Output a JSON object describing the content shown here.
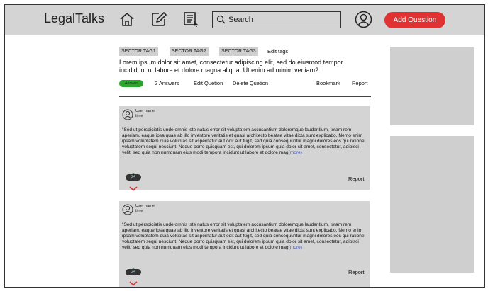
{
  "header": {
    "brand": "LegalTalks",
    "search_placeholder": "Search",
    "add_question_label": "Add Question",
    "accent_color": "#e03232"
  },
  "question": {
    "tags": [
      "SECTOR TAG1",
      "SECTOR TAG2",
      "SECTOR TAG3"
    ],
    "edit_tags_label": "Edit tags",
    "title": "Lorem ipsum dolor sit amet, consectetur adipiscing elit, sed do eiusmod tempor incididunt ut labore et dolore magna aliqua. Ut enim ad minim veniam?",
    "answer_label": "Answer",
    "answers_count": "2 Answers",
    "edit_label": "Edit Quetion",
    "delete_label": "Delete Quetion",
    "bookmark_label": "Bookmark",
    "report_label": "Report"
  },
  "answers": [
    {
      "user": "User name",
      "time": "time",
      "text": "\"Sed ut perspiciatis unde omnis iste natus error sit voluptatem accusantium doloremque laudantium, totam rem aperiam, eaque ipsa quae ab illo inventore veritatis et quasi architecto beatae vitae dicta sunt explicabo. Nemo enim ipsam voluptatem quia voluptas sit aspernatur aut odit aut fugit, sed quia consequuntur magni dolores eos qui ratione voluptatem sequi nesciunt. Neque porro quisquam est, qui dolorem ipsum quia dolor sit amet, consectetur, adipisci velit, sed quia non numquam eius modi tempora incidunt ut labore et dolore mag",
      "more": "(more)",
      "votes": "24",
      "report": "Report"
    },
    {
      "user": "User name",
      "time": "time",
      "text": "\"Sed ut perspiciatis unde omnis iste natus error sit voluptatem accusantium doloremque laudantium, totam rem aperiam, eaque ipsa quae ab illo inventore veritatis et quasi architecto beatae vitae dicta sunt explicabo. Nemo enim ipsam voluptatem quia voluptas sit aspernatur aut odit aut fugit, sed quia consequuntur magni dolores eos qui ratione voluptatem sequi nesciunt. Neque porro quisquam est, qui dolorem ipsum quia dolor sit amet, consectetur, adipisci velit, sed quia non numquam eius modi tempora incidunt ut labore et dolore mag",
      "more": "(more)",
      "votes": "24",
      "report": "Report"
    }
  ],
  "icons": {
    "home": "home-icon",
    "edit": "edit-icon",
    "news": "news-icon",
    "search": "search-icon",
    "profile": "profile-icon",
    "upvote": "chevron-up-icon",
    "downvote": "chevron-down-icon"
  }
}
